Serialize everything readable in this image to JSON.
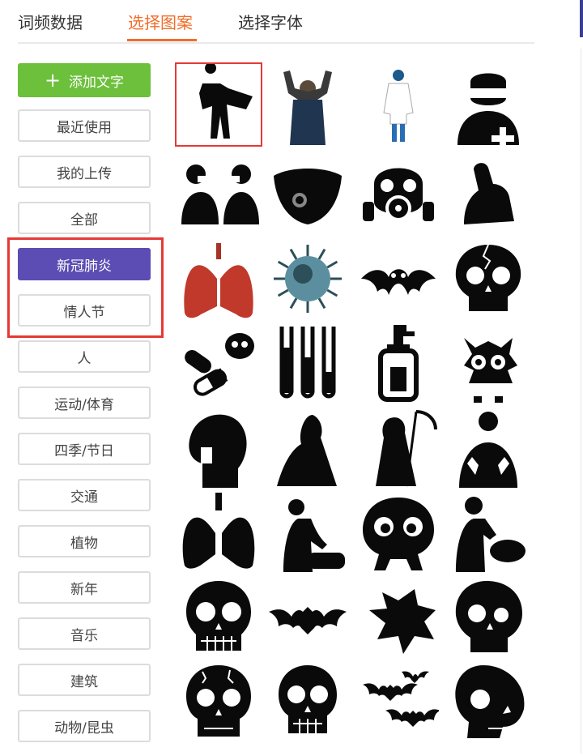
{
  "tabs": [
    {
      "label": "词频数据",
      "active": false
    },
    {
      "label": "选择图案",
      "active": true
    },
    {
      "label": "选择字体",
      "active": false
    }
  ],
  "sidebar": {
    "add_button": "添加文字",
    "categories": [
      {
        "label": "最近使用"
      },
      {
        "label": "我的上传"
      },
      {
        "label": "全部"
      },
      {
        "label": "新冠肺炎",
        "active": true
      },
      {
        "label": "情人节"
      },
      {
        "label": "人"
      },
      {
        "label": "运动/体育"
      },
      {
        "label": "四季/节日"
      },
      {
        "label": "交通"
      },
      {
        "label": "植物"
      },
      {
        "label": "新年"
      },
      {
        "label": "音乐"
      },
      {
        "label": "建筑"
      },
      {
        "label": "动物/昆虫"
      }
    ]
  },
  "grid": {
    "selected_index": 0,
    "items": [
      "superhero-cape",
      "victory-man",
      "doctor-coat",
      "surgeon-cross",
      "masked-people",
      "face-mask",
      "gas-mask",
      "flexing-arm",
      "lungs-red",
      "virus-cell",
      "bat-face",
      "cracked-skull",
      "pills-skull",
      "test-tubes",
      "sanitizer-bottle",
      "spiky-monster",
      "head-cross-section",
      "hooded-figure",
      "grim-reaper",
      "surgeon-gloves",
      "lungs-black",
      "doctor-patient",
      "octopus-eyes",
      "dentist",
      "skull-teeth",
      "flying-bat",
      "flying-squirrel",
      "skull-side",
      "cracked-skull-2",
      "skull-front",
      "bats-group",
      "skull-profile"
    ]
  },
  "colors": {
    "accent": "#f06e2a",
    "add_green": "#6cc03b",
    "active_purple": "#5b4db3",
    "highlight_red": "#e53935"
  }
}
